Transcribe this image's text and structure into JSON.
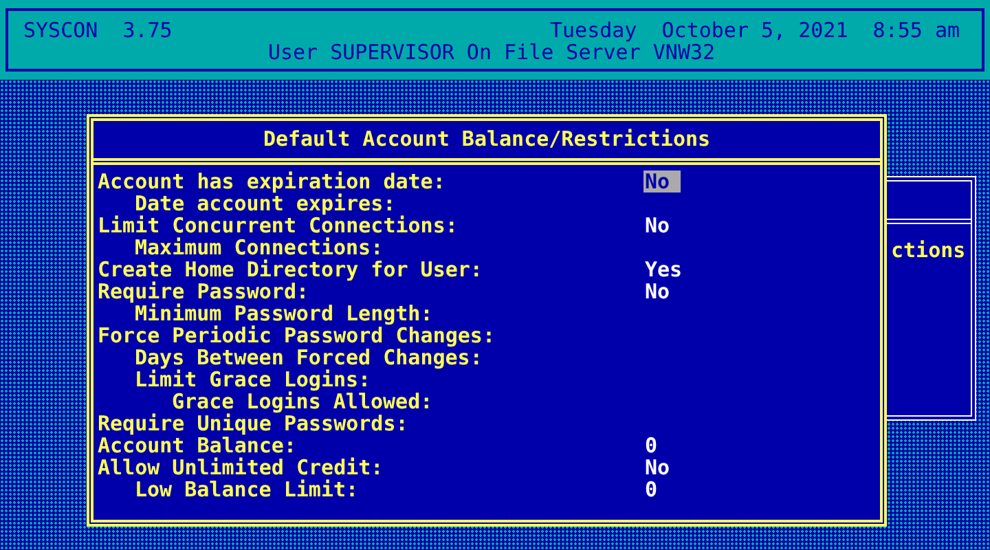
{
  "header": {
    "app": "SYSCON",
    "version": "3.75",
    "datetime": "Tuesday  October 5, 2021  8:55 am",
    "subtitle": "User SUPERVISOR On File Server VNW32"
  },
  "back_window": {
    "text": "ctions"
  },
  "dialog": {
    "title": "Default Account Balance/Restrictions",
    "fields": [
      {
        "label": "Account has expiration date:",
        "value": "No",
        "selected": true,
        "children": [
          {
            "label": "Date account expires:"
          }
        ]
      },
      {
        "label": "Limit Concurrent Connections:",
        "value": "No",
        "selected": false,
        "children": [
          {
            "label": "Maximum Connections:"
          }
        ]
      },
      {
        "label": "Create Home Directory for User:",
        "value": "Yes",
        "selected": false
      },
      {
        "label": "Require Password:",
        "value": "No",
        "selected": false,
        "children": [
          {
            "label": "Minimum Password Length:"
          }
        ]
      },
      {
        "label": "Force Periodic Password Changes:",
        "children": [
          {
            "label": "Days Between Forced Changes:"
          },
          {
            "label": "Limit Grace Logins:",
            "children": [
              {
                "label": "Grace Logins Allowed:"
              }
            ]
          }
        ]
      },
      {
        "label": "Require Unique Passwords:"
      },
      {
        "label": "Account Balance:",
        "value": "0",
        "selected": false
      },
      {
        "label": "Allow Unlimited Credit:",
        "value": "No",
        "selected": false,
        "children": [
          {
            "label": "Low Balance Limit:",
            "value": "0",
            "selected": false
          }
        ]
      }
    ]
  }
}
